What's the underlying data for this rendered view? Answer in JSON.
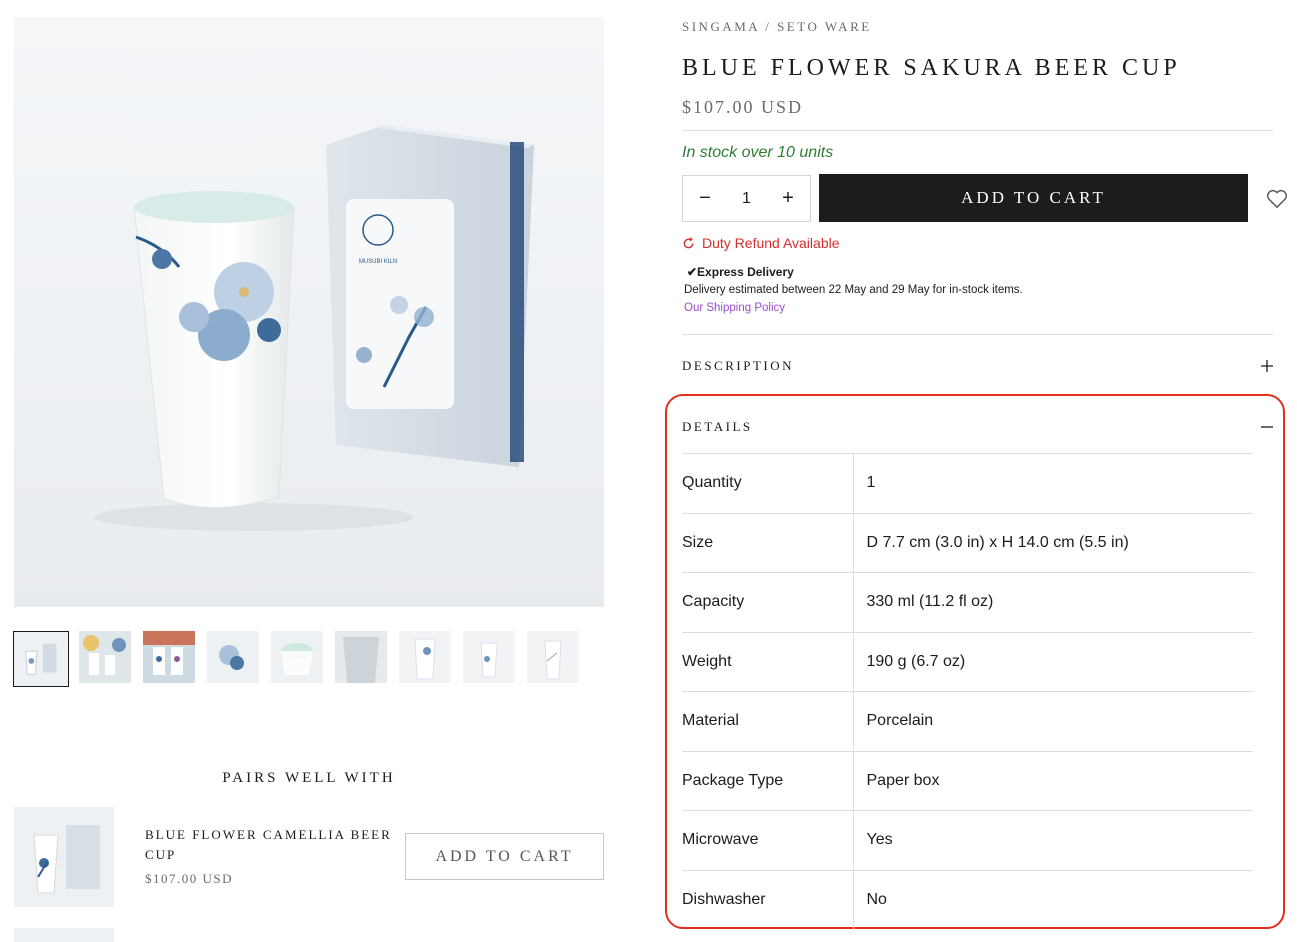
{
  "breadcrumb": "SINGAMA / SETO WARE",
  "product": {
    "title": "BLUE FLOWER SAKURA BEER CUP",
    "price": "$107.00 USD",
    "stock": "In stock over 10 units",
    "quantity": "1",
    "add_to_cart": "ADD TO CART"
  },
  "duty": "Duty Refund Available",
  "delivery": {
    "heading": "✔Express Delivery",
    "text": "Delivery estimated between 22 May and 29 May for in-stock items.",
    "policy_link": "Our Shipping Policy"
  },
  "accordion": {
    "description": "DESCRIPTION",
    "details": "DETAILS"
  },
  "details": [
    {
      "key": "Quantity",
      "value": "1"
    },
    {
      "key": "Size",
      "value": "D 7.7 cm (3.0 in) x H 14.0 cm (5.5 in)"
    },
    {
      "key": "Capacity",
      "value": "330 ml (11.2 fl oz)"
    },
    {
      "key": "Weight",
      "value": "190 g (6.7 oz)"
    },
    {
      "key": "Material",
      "value": "Porcelain"
    },
    {
      "key": "Package Type",
      "value": "Paper box"
    },
    {
      "key": "Microwave",
      "value": "Yes"
    },
    {
      "key": "Dishwasher",
      "value": "No"
    }
  ],
  "pairs": {
    "title": "PAIRS WELL WITH",
    "items": [
      {
        "name": "BLUE FLOWER CAMELLIA BEER CUP",
        "price": "$107.00 USD",
        "button": "ADD TO CART"
      }
    ]
  },
  "box_label": "MUSUBI KILN",
  "icons": {
    "minus": "minus-icon",
    "plus": "plus-icon",
    "wishlist": "heart-icon",
    "duty": "refresh-icon",
    "accordion_open": "plus-icon",
    "accordion_close": "minus-icon"
  },
  "colors": {
    "accent": "#1c1c1c",
    "stock": "#2e7d32",
    "duty": "#d32f2f",
    "link": "#9b4dca",
    "highlight": "#e0311d"
  }
}
